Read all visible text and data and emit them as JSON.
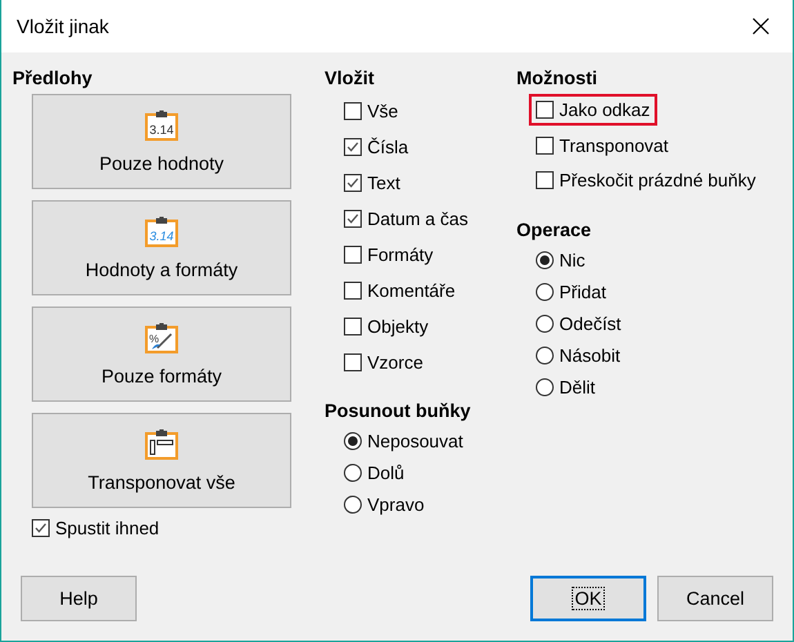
{
  "window": {
    "title": "Vložit jinak"
  },
  "presets": {
    "heading": "Předlohy",
    "items": [
      {
        "label": "Pouze hodnoty",
        "kind": "values",
        "icon_text": "3.14"
      },
      {
        "label": "Hodnoty a formáty",
        "kind": "styled",
        "icon_text": "3.14"
      },
      {
        "label": "Pouze formáty",
        "kind": "formats",
        "icon_text": "%"
      },
      {
        "label": "Transponovat vše",
        "kind": "transpose"
      }
    ],
    "run_immediately": {
      "label": "Spustit ihned",
      "checked": true
    }
  },
  "paste": {
    "heading": "Vložit",
    "items": [
      {
        "label": "Vše",
        "checked": false
      },
      {
        "label": "Čísla",
        "checked": true
      },
      {
        "label": "Text",
        "checked": true
      },
      {
        "label": "Datum a čas",
        "checked": true
      },
      {
        "label": "Formáty",
        "checked": false
      },
      {
        "label": "Komentáře",
        "checked": false
      },
      {
        "label": "Objekty",
        "checked": false
      },
      {
        "label": "Vzorce",
        "checked": false
      }
    ]
  },
  "shift_cells": {
    "heading": "Posunout buňky",
    "items": [
      {
        "label": "Neposouvat",
        "selected": true
      },
      {
        "label": "Dolů",
        "selected": false
      },
      {
        "label": "Vpravo",
        "selected": false
      }
    ]
  },
  "options": {
    "heading": "Možnosti",
    "items": [
      {
        "label": "Jako odkaz",
        "checked": false,
        "highlighted": true
      },
      {
        "label": "Transponovat",
        "checked": false,
        "highlighted": false
      },
      {
        "label": "Přeskočit prázdné buňky",
        "checked": false,
        "highlighted": false
      }
    ]
  },
  "operations": {
    "heading": "Operace",
    "items": [
      {
        "label": "Nic",
        "selected": true
      },
      {
        "label": "Přidat",
        "selected": false
      },
      {
        "label": "Odečíst",
        "selected": false
      },
      {
        "label": "Násobit",
        "selected": false
      },
      {
        "label": "Dělit",
        "selected": false
      }
    ]
  },
  "buttons": [
    {
      "label": "Help",
      "focused": false
    },
    {
      "label": "OK",
      "focused": true
    },
    {
      "label": "Cancel",
      "focused": false
    }
  ]
}
